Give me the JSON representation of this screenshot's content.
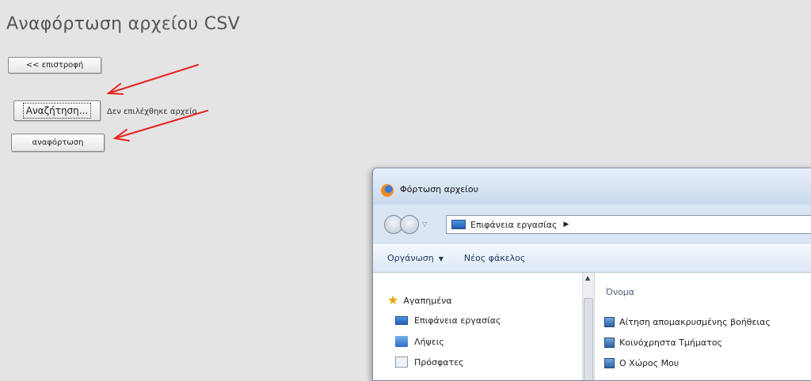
{
  "page": {
    "title": "Αναφόρτωση αρχείου CSV",
    "back_label": "<< επιστροφή",
    "browse_label": "Αναζήτηση...",
    "no_file_text": "Δεν επιλέχθηκε αρχείο.",
    "upload_label": "αναφόρτωση"
  },
  "colors": {
    "arrow": "#e8231c",
    "background": "#e4e4e4"
  },
  "dialog": {
    "title": "Φόρτωση αρχείου",
    "address": "Επιφάνεια εργασίας",
    "toolbar": {
      "organize_label": "Οργάνωση",
      "new_folder_label": "Νέος φάκελος"
    },
    "nav_pane": {
      "items": [
        {
          "label": "Αγαπημένα",
          "icon": "star-icon"
        },
        {
          "label": "Επιφάνεια εργασίας",
          "icon": "desktop-icon"
        },
        {
          "label": "Λήψεις",
          "icon": "downloads-icon"
        },
        {
          "label": "Πρόσφατες",
          "icon": "recent-places-icon"
        }
      ]
    },
    "file_pane": {
      "column_header": "Όνομα",
      "items": [
        {
          "label": "Αίτηση απομακρυσμένης βοήθειας",
          "icon": "network-shortcut-icon"
        },
        {
          "label": "Κοινόχρηστα Τμήματος",
          "icon": "network-shortcut-icon"
        },
        {
          "label": "Ο Χώρος Μου",
          "icon": "network-shortcut-icon"
        }
      ]
    }
  }
}
